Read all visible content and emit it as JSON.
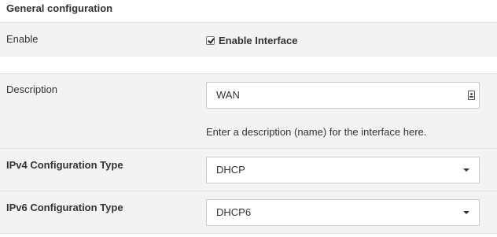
{
  "section": {
    "title": "General configuration"
  },
  "enable": {
    "label": "Enable",
    "checkbox_label": "Enable Interface",
    "checked": true
  },
  "description": {
    "label": "Description",
    "value": "WAN",
    "help": "Enter a description (name) for the interface here."
  },
  "ipv4": {
    "label": "IPv4 Configuration Type",
    "selected": "DHCP"
  },
  "ipv6": {
    "label": "IPv6 Configuration Type",
    "selected": "DHCP6"
  }
}
